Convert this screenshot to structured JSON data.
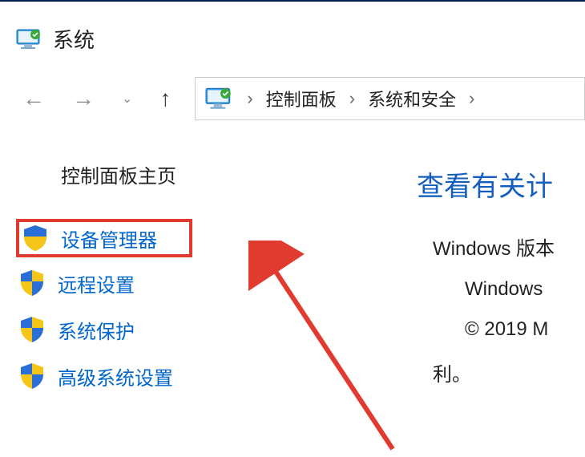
{
  "window": {
    "title": "系统"
  },
  "breadcrumb": {
    "item1": "控制面板",
    "item2": "系统和安全"
  },
  "sidebar": {
    "home": "控制面板主页",
    "items": [
      {
        "label": "设备管理器"
      },
      {
        "label": "远程设置"
      },
      {
        "label": "系统保护"
      },
      {
        "label": "高级系统设置"
      }
    ]
  },
  "content": {
    "heading": "查看有关计",
    "version_label": "Windows 版本",
    "windows_line": "Windows",
    "copyright_line": "© 2019 M",
    "rights_line": "利。"
  }
}
